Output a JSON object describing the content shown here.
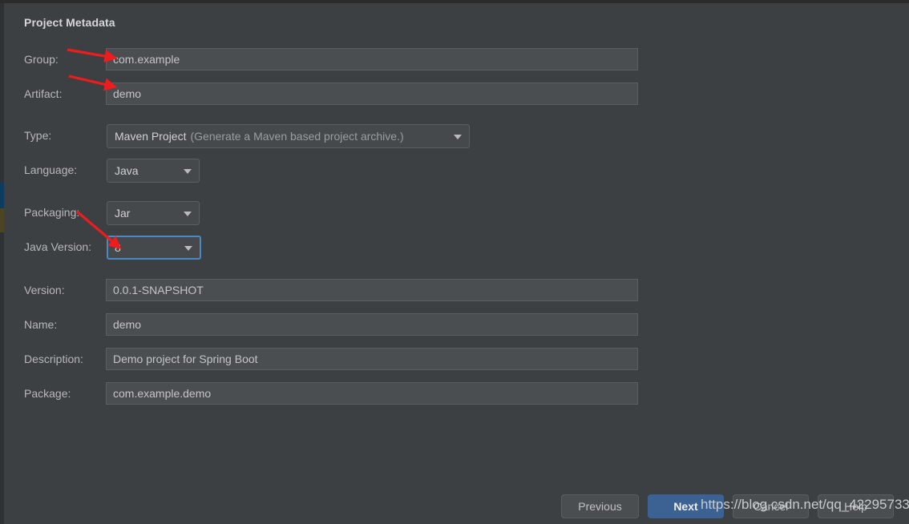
{
  "dialog": {
    "panel_title": "Project Metadata"
  },
  "fields": {
    "group": {
      "label": "Group:",
      "value": "com.example"
    },
    "artifact": {
      "label": "Artifact:",
      "value": "demo"
    },
    "type": {
      "label": "Type:",
      "value_main": "Maven Project",
      "value_hint": "(Generate a Maven based project archive.)"
    },
    "language": {
      "label": "Language:",
      "value": "Java"
    },
    "packaging": {
      "label": "Packaging:",
      "value": "Jar"
    },
    "java_version": {
      "label": "Java Version:",
      "value": "8"
    },
    "version": {
      "label": "Version:",
      "value": "0.0.1-SNAPSHOT"
    },
    "name": {
      "label": "Name:",
      "value": "demo"
    },
    "description": {
      "label": "Description:",
      "value": "Demo project for Spring Boot"
    },
    "package": {
      "label": "Package:",
      "value": "com.example.demo"
    }
  },
  "buttons": {
    "previous": "Previous",
    "next": "Next",
    "cancel": "Cancel",
    "help": "Help"
  },
  "watermark": {
    "text": "https://blog.csdn.net/qq_42295733"
  },
  "colors": {
    "background": "#3c4043",
    "field_background": "#4a4e51",
    "focus_border": "#4b88c4",
    "primary_button": "#3c6193",
    "annotation_red": "#ee1c1c"
  }
}
